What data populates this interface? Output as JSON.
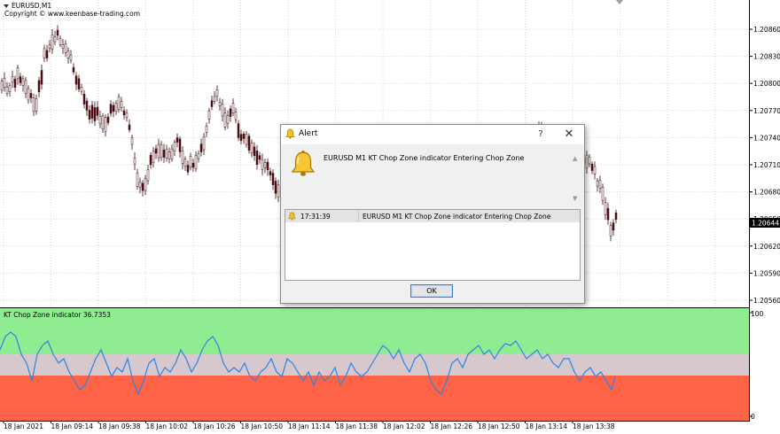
{
  "chart_header": {
    "symbol": "EURUSD,M1",
    "copyright": "Copyright © www.keenbase-trading.com"
  },
  "price_axis": {
    "labels": [
      "1.20860",
      "1.20830",
      "1.20800",
      "1.20770",
      "1.20740",
      "1.20710",
      "1.20680",
      "1.20650",
      "1.20620",
      "1.20590",
      "1.20560"
    ],
    "current_price": "1.20644"
  },
  "indicator": {
    "label": "KT Chop Zone indicator 36.7353",
    "axis_top": "100",
    "axis_bottom": "0"
  },
  "time_axis": {
    "labels": [
      "18 Jan 2021",
      "18 Jan 09:14",
      "18 Jan 09:38",
      "18 Jan 10:02",
      "18 Jan 10:26",
      "18 Jan 10:50",
      "18 Jan 11:14",
      "18 Jan 11:38",
      "18 Jan 12:02",
      "18 Jan 12:26",
      "18 Jan 12:50",
      "18 Jan 13:14",
      "18 Jan 13:38"
    ]
  },
  "alert_dialog": {
    "title": "Alert",
    "help_label": "?",
    "close_label": "✕",
    "message": "EURUSD M1 KT Chop Zone indicator Entering Chop Zone",
    "rows": [
      {
        "time": "17:31:39",
        "message": "EURUSD M1 KT Chop Zone indicator Entering Chop Zone"
      }
    ],
    "ok_label": "OK",
    "icon": "bell-icon"
  },
  "colors": {
    "upper_zone": "#90ec90",
    "middle_zone": "#d6c8cc",
    "lower_zone": "#fe6347",
    "indicator_line": "#2a84e8",
    "candle": "#5a0a14"
  }
}
